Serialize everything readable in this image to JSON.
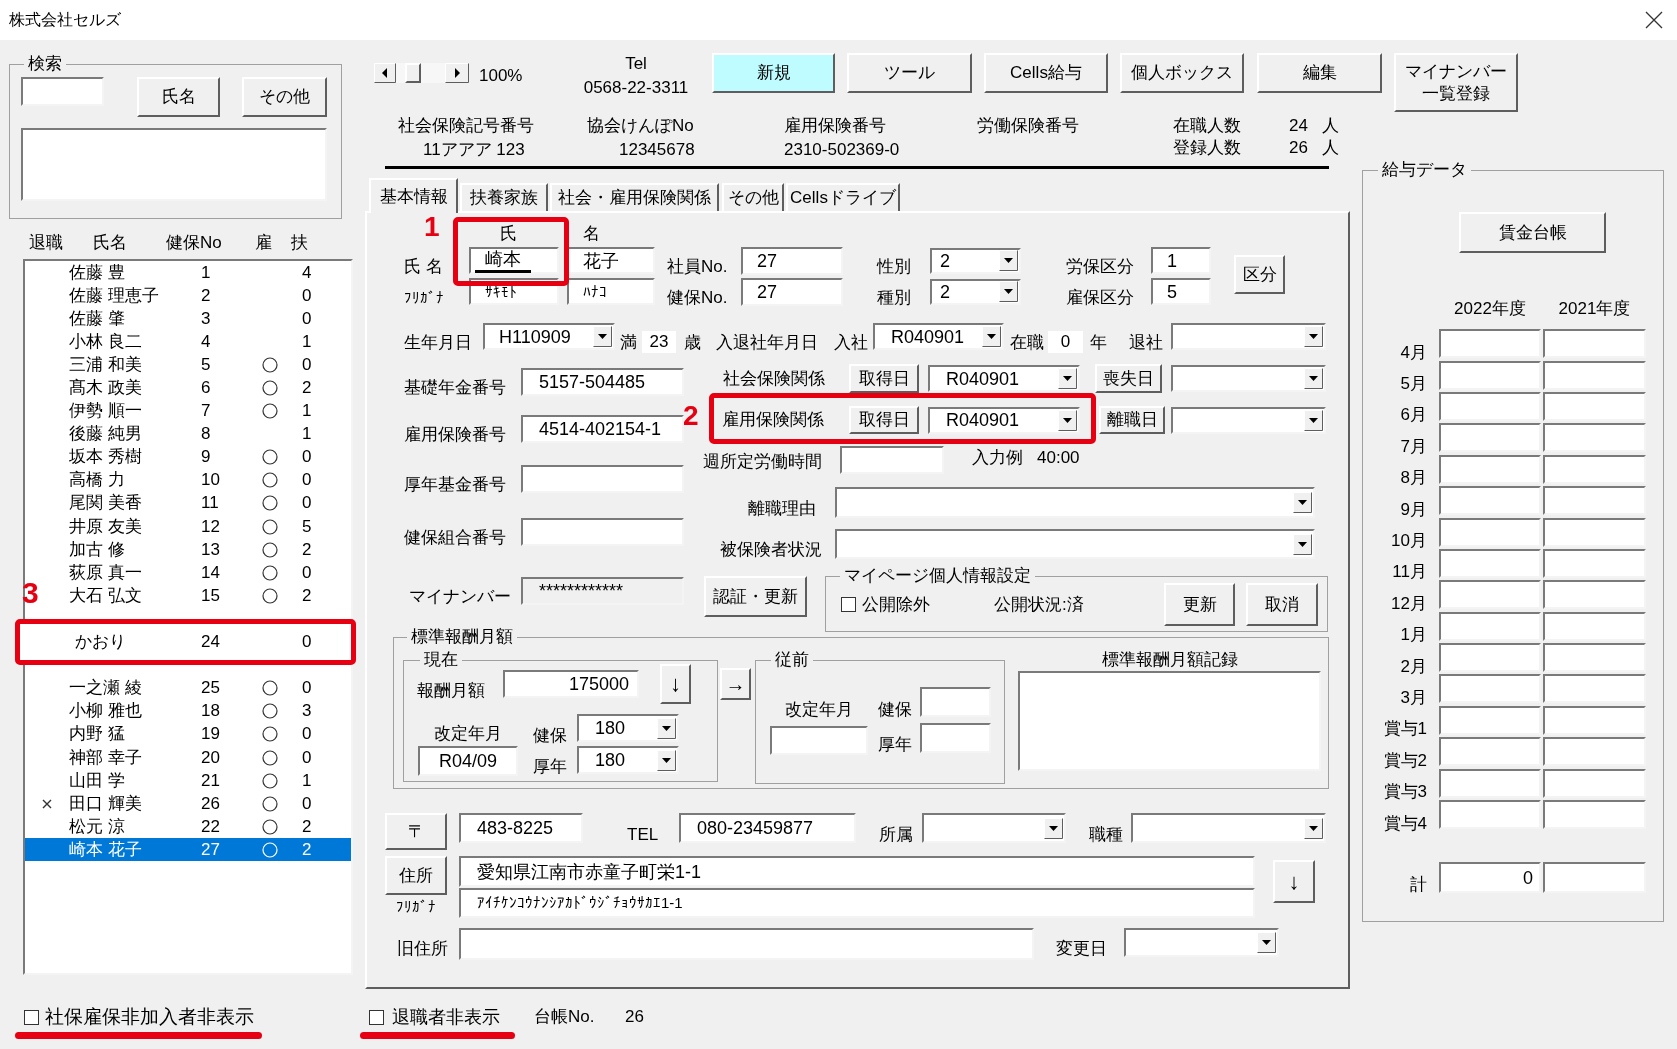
{
  "window": {
    "title": "株式会社セルズ"
  },
  "search": {
    "legend": "検索",
    "buttons": [
      "氏名",
      "その他"
    ]
  },
  "employee_list": {
    "columns": [
      "退職",
      "氏名",
      "健保No",
      "雇",
      "扶"
    ],
    "rows": [
      {
        "kind": "row",
        "retired": false,
        "name": "佐藤 豊",
        "no": "1",
        "insured": false,
        "dependents": "4",
        "selected": false
      },
      {
        "kind": "row",
        "retired": false,
        "name": "佐藤 理恵子",
        "no": "2",
        "insured": false,
        "dependents": "0",
        "selected": false
      },
      {
        "kind": "row",
        "retired": false,
        "name": "佐藤 肇",
        "no": "3",
        "insured": false,
        "dependents": "0",
        "selected": false
      },
      {
        "kind": "row",
        "retired": false,
        "name": "小林 良二",
        "no": "4",
        "insured": false,
        "dependents": "1",
        "selected": false
      },
      {
        "kind": "row",
        "retired": false,
        "name": "三浦 和美",
        "no": "5",
        "insured": true,
        "dependents": "0",
        "selected": false
      },
      {
        "kind": "row",
        "retired": false,
        "name": "髙木 政美",
        "no": "6",
        "insured": true,
        "dependents": "2",
        "selected": false
      },
      {
        "kind": "row",
        "retired": false,
        "name": "伊勢 順一",
        "no": "7",
        "insured": true,
        "dependents": "1",
        "selected": false
      },
      {
        "kind": "row",
        "retired": false,
        "name": "後藤 純男",
        "no": "8",
        "insured": false,
        "dependents": "1",
        "selected": false
      },
      {
        "kind": "row",
        "retired": false,
        "name": "坂本 秀樹",
        "no": "9",
        "insured": true,
        "dependents": "0",
        "selected": false
      },
      {
        "kind": "row",
        "retired": false,
        "name": "高橋 力",
        "no": "10",
        "insured": true,
        "dependents": "0",
        "selected": false
      },
      {
        "kind": "row",
        "retired": false,
        "name": "尾関 美香",
        "no": "11",
        "insured": true,
        "dependents": "0",
        "selected": false
      },
      {
        "kind": "row",
        "retired": false,
        "name": "井原 友美",
        "no": "12",
        "insured": true,
        "dependents": "5",
        "selected": false
      },
      {
        "kind": "row",
        "retired": false,
        "name": "加古 修",
        "no": "13",
        "insured": true,
        "dependents": "2",
        "selected": false
      },
      {
        "kind": "row",
        "retired": false,
        "name": "荻原 真一",
        "no": "14",
        "insured": true,
        "dependents": "0",
        "selected": false
      },
      {
        "kind": "row",
        "retired": false,
        "name": "大石 弘文",
        "no": "15",
        "insured": true,
        "dependents": "2",
        "selected": false
      },
      {
        "kind": "callout",
        "callout": "3",
        "retired": false,
        "name": "かおり",
        "no": "24",
        "insured": false,
        "dependents": "0",
        "selected": false
      },
      {
        "kind": "row",
        "retired": false,
        "name": "一之瀬 綾",
        "no": "25",
        "insured": true,
        "dependents": "0",
        "selected": false
      },
      {
        "kind": "row",
        "retired": false,
        "name": "小柳 雅也",
        "no": "18",
        "insured": true,
        "dependents": "3",
        "selected": false
      },
      {
        "kind": "row",
        "retired": false,
        "name": "内野 猛",
        "no": "19",
        "insured": true,
        "dependents": "0",
        "selected": false
      },
      {
        "kind": "row",
        "retired": false,
        "name": "神部 幸子",
        "no": "20",
        "insured": true,
        "dependents": "0",
        "selected": false
      },
      {
        "kind": "row",
        "retired": false,
        "name": "山田 学",
        "no": "21",
        "insured": true,
        "dependents": "1",
        "selected": false
      },
      {
        "kind": "row",
        "retired": true,
        "name": "田口 輝美",
        "no": "26",
        "insured": true,
        "dependents": "0",
        "selected": false
      },
      {
        "kind": "row",
        "retired": false,
        "name": "松元 涼",
        "no": "22",
        "insured": true,
        "dependents": "2",
        "selected": false
      },
      {
        "kind": "row",
        "retired": false,
        "name": "崎本 花子",
        "no": "27",
        "insured": true,
        "dependents": "2",
        "selected": true
      }
    ]
  },
  "hide_uninsured": {
    "label": "社保雇保非加入者非表示",
    "checked": false,
    "underlined": true
  },
  "zoom_level": "100%",
  "tel": {
    "label": "Tel",
    "number": "0568-22-3311"
  },
  "toolbar_buttons": [
    {
      "label": "新規",
      "highlighted": true
    },
    {
      "label": "ツール",
      "highlighted": false
    },
    {
      "label": "Cells給与",
      "highlighted": false
    },
    {
      "label": "個人ボックス",
      "highlighted": false
    },
    {
      "label": "編集",
      "highlighted": false
    },
    {
      "label": "マイナンバー一覧登録",
      "highlighted": false
    }
  ],
  "company_info": [
    {
      "label": "社会保険記号番号",
      "value": "11アアア 123"
    },
    {
      "label": "協会けんぽNo",
      "value": "12345678"
    },
    {
      "label": "雇用保険番号",
      "value": "2310-502369-0"
    },
    {
      "label": "労働保険番号"
    }
  ],
  "headcount": [
    {
      "label": "在職人数",
      "value": "24",
      "unit": "人"
    },
    {
      "label": "登録人数",
      "value": "26",
      "unit": "人"
    }
  ],
  "tabs": [
    {
      "label": "基本情報",
      "selected": true
    },
    {
      "label": "扶養家族",
      "selected": false
    },
    {
      "label": "社会・雇用保険関係",
      "selected": false
    },
    {
      "label": "その他",
      "selected": false
    },
    {
      "label": "Cellsドライブ",
      "selected": false
    }
  ],
  "basic": {
    "name_headers": [
      "氏",
      "名"
    ],
    "name": {
      "label": "氏 名",
      "surname": "崎本",
      "given": "花子",
      "composing": true,
      "callout": "1"
    },
    "furigana": {
      "label": "ﾌﾘｶﾞﾅ",
      "surname": "ｻｷﾓﾄ",
      "given": "ﾊﾅｺ"
    },
    "employee_no": {
      "label": "社員No.",
      "value": "27"
    },
    "kenpo_no": {
      "label": "健保No.",
      "value": "27"
    },
    "gender": {
      "label": "性別",
      "value": "2"
    },
    "category": {
      "label": "種別",
      "value": "2"
    },
    "labor_class": {
      "label": "労保区分",
      "value": "1"
    },
    "employment_class": {
      "label": "雇保区分",
      "value": "5"
    },
    "class_button": "区分",
    "birth": {
      "label": "生年月日",
      "value": "H110909",
      "age_prefix": "満",
      "age": "23",
      "age_unit": "歳"
    },
    "employment_dates": {
      "label": "入退社年月日",
      "join_label": "入社",
      "join": "R040901",
      "tenure_label": "在職",
      "tenure": "0",
      "tenure_unit": "年",
      "leave_label": "退社"
    },
    "id_fields": [
      {
        "label": "基礎年金番号",
        "value": "5157-504485",
        "disabled": false
      },
      {
        "label": "雇用保険番号",
        "value": "4514-402154-1",
        "disabled": false
      },
      {
        "label": "厚年基金番号",
        "disabled": false
      },
      {
        "label": "健保組合番号",
        "disabled": false
      },
      {
        "label": "マイナンバー",
        "value": "************",
        "disabled": true
      }
    ],
    "insurance": [
      {
        "label": "社会保険関係",
        "acquired_button": "取得日",
        "acquired": "R040901",
        "end_button": "喪失日"
      },
      {
        "label": "雇用保険関係",
        "acquired_button": "取得日",
        "acquired": "R040901",
        "end_button": "離職日",
        "callout": "2"
      }
    ],
    "weekly_hours": {
      "label": "週所定労働時間",
      "example_label": "入力例",
      "example": "40:00"
    },
    "separation_reason": {
      "label": "離職理由"
    },
    "insured_status": {
      "label": "被保険者状況"
    },
    "verify_button": "認証・更新",
    "mypage": {
      "legend": "マイページ個人情報設定",
      "exclude_label": "公開除外",
      "exclude_checked": false,
      "status": "公開状況:済",
      "buttons": [
        "更新",
        "取消"
      ]
    },
    "remuneration": {
      "legend": "標準報酬月額",
      "current": {
        "legend": "現在",
        "amount_label": "報酬月額",
        "amount": "175000",
        "down_button": "↓",
        "revision_label": "改定年月",
        "revision": "R04/09",
        "health_label": "健保",
        "health": "180",
        "pension_label": "厚年",
        "pension": "180"
      },
      "copy_button": "→",
      "previous": {
        "legend": "従前",
        "revision_label": "改定年月",
        "health_label": "健保",
        "pension_label": "厚年"
      },
      "history_label": "標準報酬月額記録"
    },
    "address": {
      "postal_button": "〒",
      "postal": "483-8225",
      "tel_label": "TEL",
      "tel": "080-23459877",
      "department_label": "所属",
      "job_label": "職種",
      "address_button": "住所",
      "address": "愛知県江南市赤童子町栄1-1",
      "furigana_label": "ﾌﾘｶﾞﾅ",
      "furigana": "ｱｲﾁｹﾝｺｳﾅﾝｼｱｶﾄﾞｳｼﾞﾁｮｳｻｶｴ1-1",
      "move_button": "↓",
      "old_address_label": "旧住所",
      "changed_label": "変更日"
    }
  },
  "hide_retired": {
    "label": "退職者非表示",
    "checked": false,
    "underlined": true
  },
  "ledger_no": {
    "label": "台帳No.",
    "value": "26"
  },
  "salary_data": {
    "legend": "給与データ",
    "ledger_button": "賃金台帳",
    "years": [
      "2022年度",
      "2021年度"
    ],
    "months": [
      "4月",
      "5月",
      "6月",
      "7月",
      "8月",
      "9月",
      "10月",
      "11月",
      "12月",
      "1月",
      "2月",
      "3月",
      "賞与1",
      "賞与2",
      "賞与3",
      "賞与4"
    ],
    "total_label": "計",
    "totals": [
      "0"
    ]
  }
}
